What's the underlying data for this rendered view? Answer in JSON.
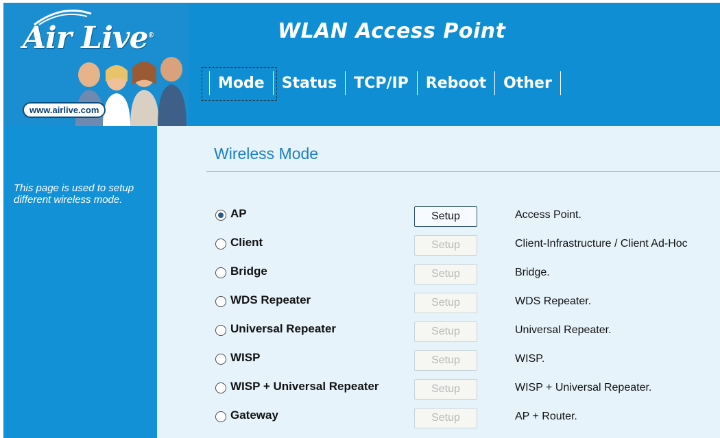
{
  "logo": {
    "text": "Air Live",
    "reg": "®",
    "website": "www.airlive.com"
  },
  "header": {
    "title": "WLAN Access Point"
  },
  "nav": [
    {
      "label": "Mode"
    },
    {
      "label": "Status"
    },
    {
      "label": "TCP/IP"
    },
    {
      "label": "Reboot"
    },
    {
      "label": "Other"
    }
  ],
  "sidebar": {
    "help_text": "This page is used to setup different wireless mode."
  },
  "main": {
    "title": "Wireless Mode",
    "setup_label": "Setup",
    "modes": [
      {
        "label": "AP",
        "desc": "Access Point.",
        "selected": true
      },
      {
        "label": "Client",
        "desc": "Client-Infrastructure / Client Ad-Hoc",
        "selected": false
      },
      {
        "label": "Bridge",
        "desc": "Bridge.",
        "selected": false
      },
      {
        "label": "WDS Repeater",
        "desc": "WDS Repeater.",
        "selected": false
      },
      {
        "label": "Universal Repeater",
        "desc": "Universal Repeater.",
        "selected": false
      },
      {
        "label": "WISP",
        "desc": "WISP.",
        "selected": false
      },
      {
        "label": "WISP + Universal Repeater",
        "desc": "WISP + Universal Repeater.",
        "selected": false
      },
      {
        "label": "Gateway",
        "desc": "AP + Router.",
        "selected": false
      }
    ]
  }
}
